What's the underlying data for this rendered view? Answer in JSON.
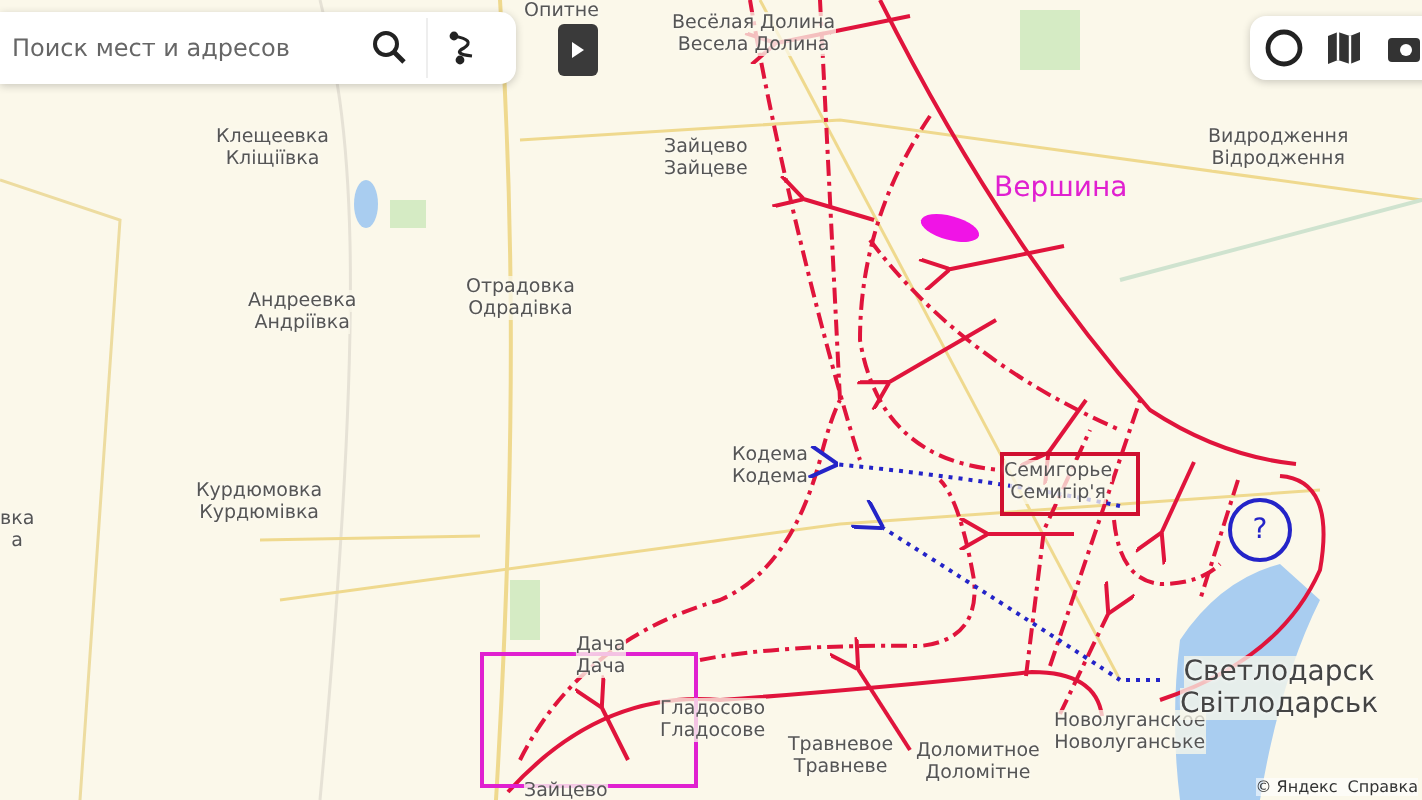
{
  "search": {
    "placeholder": "Поиск мест и адресов"
  },
  "map": {
    "places": [
      {
        "name": "Опитне"
      },
      {
        "name": "Весёлая Долина",
        "name_local": "Весела Долина"
      },
      {
        "name": "Клещеевка",
        "name_local": "Кліщіївка"
      },
      {
        "name": "Зайцево",
        "name_local": "Зайцеве"
      },
      {
        "name": "Видродження",
        "name_local": "Відродження"
      },
      {
        "name": "Андреевка",
        "name_local": "Андріївка"
      },
      {
        "name": "Отрадовка",
        "name_local": "Одрадівка"
      },
      {
        "name": "Курдюмовка",
        "name_local": "Курдюмівка"
      },
      {
        "name": "вка",
        "name_local": "а"
      },
      {
        "name": "Кодема",
        "name_local": "Кодема"
      },
      {
        "name": "Семигорье",
        "name_local": "Семигір'я"
      },
      {
        "name": "Дача",
        "name_local": "Дача"
      },
      {
        "name": "Гладосово",
        "name_local": "Гладосове"
      },
      {
        "name": "Травневое",
        "name_local": "Травневе"
      },
      {
        "name": "Доломитное",
        "name_local": "Доломітне"
      },
      {
        "name": "Новолуганское",
        "name_local": "Новолуганське"
      },
      {
        "name": "Светлодарск",
        "name_local": "Світлодарськ"
      },
      {
        "name": "Зайцево"
      }
    ],
    "annotations": [
      {
        "kind": "label",
        "text": "Вершина"
      },
      {
        "kind": "marker",
        "text": "?"
      }
    ]
  },
  "attribution": [
    "© Яндекс",
    "Справка"
  ]
}
